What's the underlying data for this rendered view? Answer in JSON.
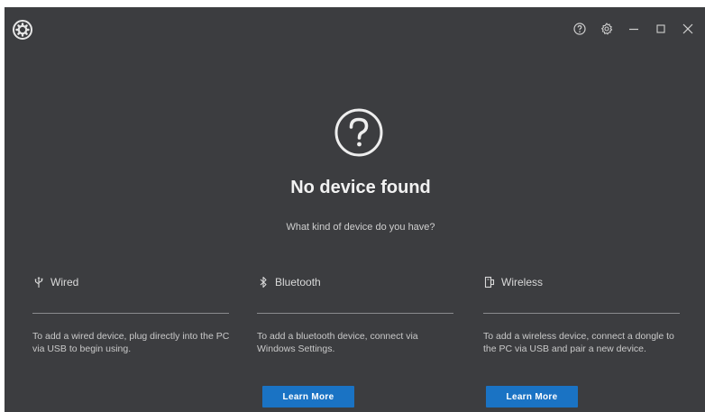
{
  "main": {
    "title": "No device found",
    "subtitle": "What kind of device do you have?"
  },
  "options": [
    {
      "label": "Wired",
      "icon": "usb-icon",
      "description": "To add a wired device, plug directly into the PC via USB to begin using."
    },
    {
      "label": "Bluetooth",
      "icon": "bluetooth-icon",
      "description": "To add a bluetooth device, connect via Windows Settings.",
      "button_label": "Learn More"
    },
    {
      "label": "Wireless",
      "icon": "dongle-icon",
      "description": "To add a wireless device, connect a dongle to the PC via USB and pair a new device.",
      "button_label": "Learn More"
    }
  ],
  "colors": {
    "background": "#3c3d40",
    "accent": "#1a73c4",
    "text": "#d9d9d9"
  }
}
